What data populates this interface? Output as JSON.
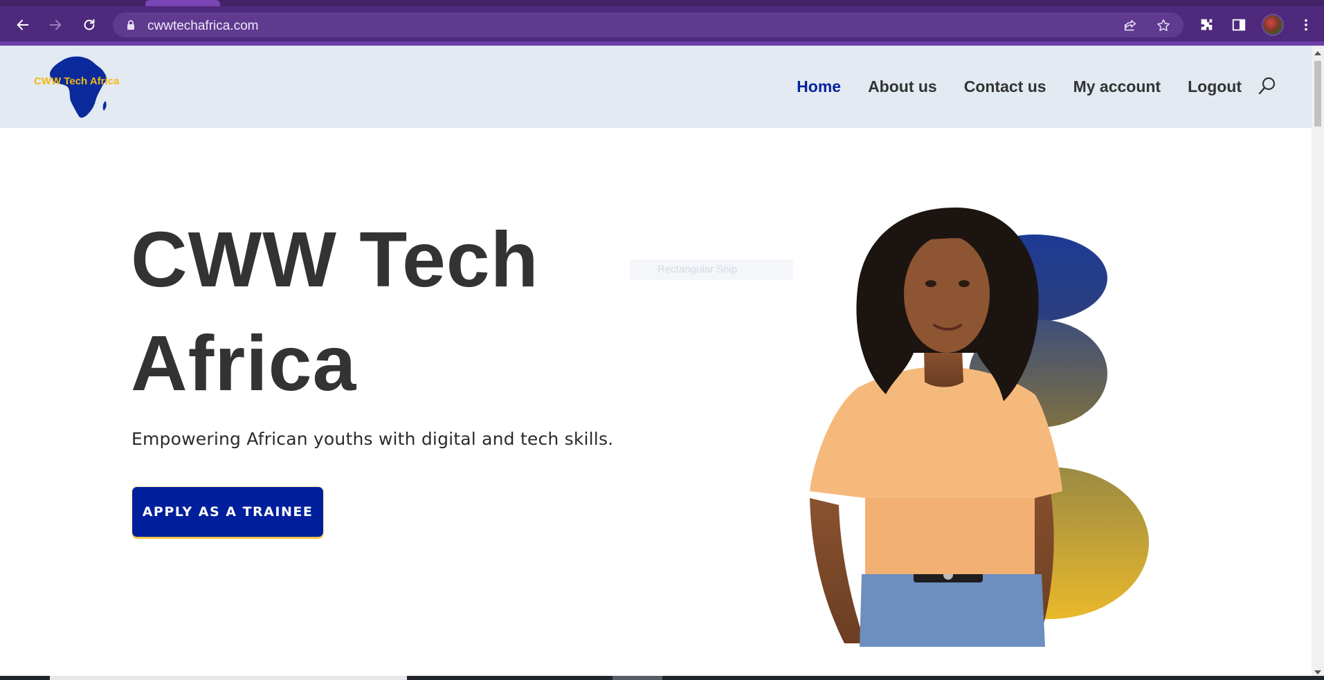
{
  "browser": {
    "url": "cwwtechafrica.com"
  },
  "site": {
    "logo_text": "CWW Tech Africa",
    "nav": [
      {
        "label": "Home",
        "active": true
      },
      {
        "label": "About us",
        "active": false
      },
      {
        "label": "Contact us",
        "active": false
      },
      {
        "label": "My account",
        "active": false
      },
      {
        "label": "Logout",
        "active": false
      }
    ]
  },
  "hero": {
    "title_line1": "CWW Tech",
    "title_line2": "Africa",
    "subtitle": "Empowering African youths with digital and tech skills.",
    "cta_label": "APPLY AS A TRAINEE"
  },
  "overlay": {
    "ghost_label": "Rectangular Snip"
  },
  "colors": {
    "chrome": "#4f2a7c",
    "header_bg": "#e3eaf2",
    "nav_active": "#08239b",
    "cta_bg": "#001f9c",
    "logo_blue": "#0b2a9c",
    "logo_gold": "#f3b915"
  },
  "icons": [
    "back-arrow-icon",
    "forward-arrow-icon",
    "reload-icon",
    "lock-icon",
    "share-icon",
    "star-icon",
    "extensions-icon",
    "side-panel-icon",
    "avatar",
    "kebab-menu-icon",
    "search-icon"
  ]
}
